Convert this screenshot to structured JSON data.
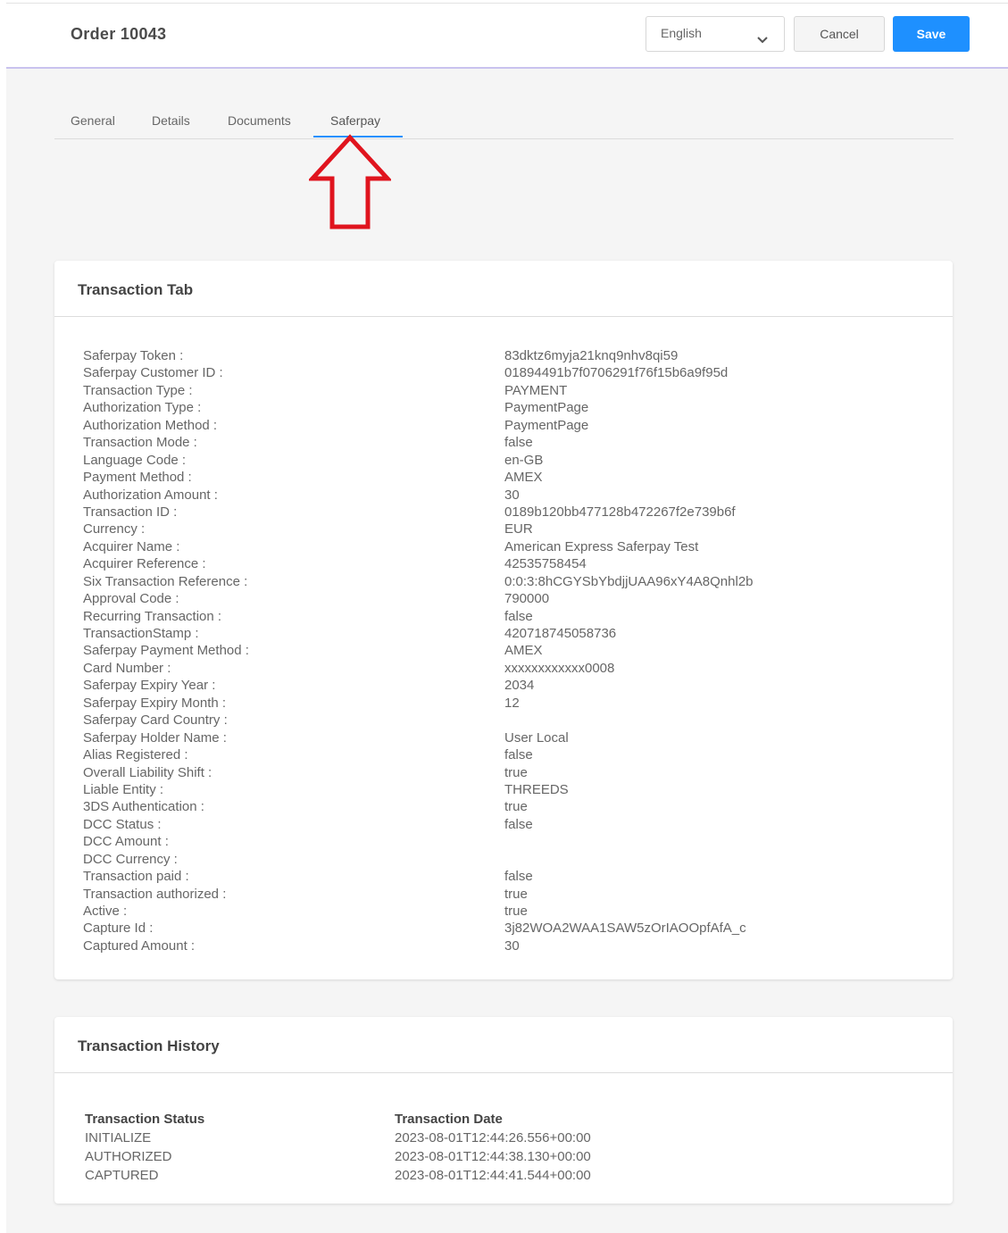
{
  "header": {
    "order_title": "Order 10043",
    "language": "English",
    "cancel_label": "Cancel",
    "save_label": "Save"
  },
  "tabs": [
    {
      "label": "General"
    },
    {
      "label": "Details"
    },
    {
      "label": "Documents"
    },
    {
      "label": "Saferpay",
      "active": true
    }
  ],
  "colors": {
    "accent": "#1e90ff",
    "arrow": "#e0141e"
  },
  "transaction": {
    "title": "Transaction Tab",
    "rows": [
      {
        "label": "Saferpay Token :",
        "value": "83dktz6myja21knq9nhv8qi59"
      },
      {
        "label": "Saferpay Customer ID :",
        "value": "01894491b7f0706291f76f15b6a9f95d"
      },
      {
        "label": "Transaction Type :",
        "value": "PAYMENT"
      },
      {
        "label": "Authorization Type :",
        "value": "PaymentPage"
      },
      {
        "label": "Authorization Method :",
        "value": "PaymentPage"
      },
      {
        "label": "Transaction Mode :",
        "value": "false"
      },
      {
        "label": "Language Code :",
        "value": "en-GB"
      },
      {
        "label": "Payment Method :",
        "value": "AMEX"
      },
      {
        "label": "Authorization Amount :",
        "value": "30"
      },
      {
        "label": "Transaction ID :",
        "value": "0189b120bb477128b472267f2e739b6f"
      },
      {
        "label": "Currency :",
        "value": "EUR"
      },
      {
        "label": "Acquirer Name :",
        "value": "American Express Saferpay Test"
      },
      {
        "label": "Acquirer Reference :",
        "value": "42535758454"
      },
      {
        "label": "Six Transaction Reference :",
        "value": "0:0:3:8hCGYSbYbdjjUAA96xY4A8Qnhl2b"
      },
      {
        "label": "Approval Code :",
        "value": "790000"
      },
      {
        "label": "Recurring Transaction :",
        "value": "false"
      },
      {
        "label": "TransactionStamp :",
        "value": "420718745058736"
      },
      {
        "label": "Saferpay Payment Method :",
        "value": "AMEX"
      },
      {
        "label": "Card Number :",
        "value": "xxxxxxxxxxxx0008"
      },
      {
        "label": "Saferpay Expiry Year :",
        "value": "2034"
      },
      {
        "label": "Saferpay Expiry Month :",
        "value": "12"
      },
      {
        "label": "Saferpay Card Country :",
        "value": ""
      },
      {
        "label": "Saferpay Holder Name :",
        "value": "User Local"
      },
      {
        "label": "Alias Registered :",
        "value": "false"
      },
      {
        "label": "Overall Liability Shift :",
        "value": "true"
      },
      {
        "label": "Liable Entity :",
        "value": "THREEDS"
      },
      {
        "label": "3DS Authentication :",
        "value": "true"
      },
      {
        "label": "DCC Status :",
        "value": "false"
      },
      {
        "label": "DCC Amount :",
        "value": ""
      },
      {
        "label": "DCC Currency :",
        "value": ""
      },
      {
        "label": "Transaction paid :",
        "value": "false"
      },
      {
        "label": "Transaction authorized :",
        "value": "true"
      },
      {
        "label": "Active :",
        "value": "true"
      },
      {
        "label": "Capture Id :",
        "value": "3j82WOA2WAA1SAW5zOrIAOOpfAfA_c"
      },
      {
        "label": "Captured Amount :",
        "value": "30"
      }
    ]
  },
  "history": {
    "title": "Transaction History",
    "columns": [
      "Transaction Status",
      "Transaction Date"
    ],
    "rows": [
      [
        "INITIALIZE",
        "2023-08-01T12:44:26.556+00:00"
      ],
      [
        "AUTHORIZED",
        "2023-08-01T12:44:38.130+00:00"
      ],
      [
        "CAPTURED",
        "2023-08-01T12:44:41.544+00:00"
      ]
    ]
  }
}
